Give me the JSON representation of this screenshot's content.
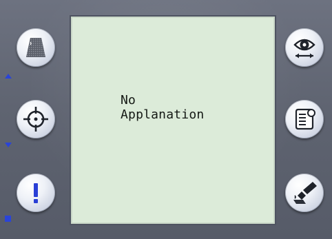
{
  "screen": {
    "message_line1": "No",
    "message_line2": "Applanation"
  },
  "left_buttons": [
    {
      "icon": "prism-cone-icon"
    },
    {
      "icon": "crosshair-target-icon"
    },
    {
      "icon": "exclamation-icon"
    }
  ],
  "right_buttons": [
    {
      "icon": "eye-left-right-icon"
    },
    {
      "icon": "printout-icon"
    },
    {
      "icon": "disinfect-prism-icon"
    }
  ],
  "indicators": {
    "up": "triangle-up",
    "down": "triangle-down",
    "status": "square"
  },
  "colors": {
    "bezel": "#5f6471",
    "screen_bg": "#dcebd9",
    "screen_text": "#141814",
    "indicator_blue": "#2a44d8",
    "icon_dark": "#2b2f38",
    "exclamation_blue": "#2a3fd6"
  }
}
